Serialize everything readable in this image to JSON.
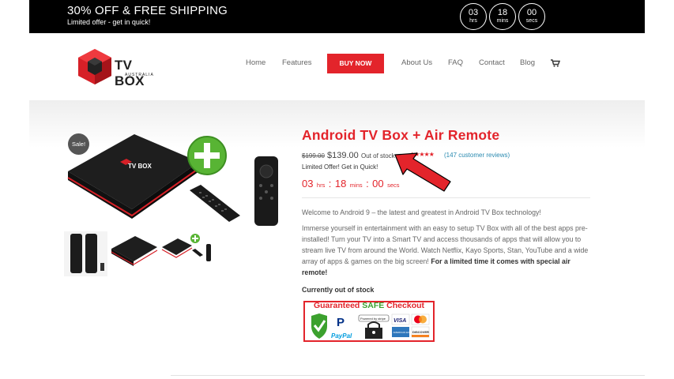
{
  "promo": {
    "title": "30% OFF & FREE SHIPPING",
    "subtitle": "Limited offer - get in quick!",
    "timer": [
      {
        "value": "03",
        "unit": "hrs"
      },
      {
        "value": "18",
        "unit": "mins"
      },
      {
        "value": "00",
        "unit": "secs"
      }
    ]
  },
  "header": {
    "logo_text": "TV BOX",
    "logo_sub": "AUSTRALIA",
    "nav": [
      "Home",
      "Features",
      "BUY NOW",
      "About Us",
      "FAQ",
      "Contact",
      "Blog"
    ],
    "cart_icon": "cart-icon"
  },
  "gallery": {
    "sale_badge": "Sale!"
  },
  "product": {
    "title": "Android TV Box + Air Remote",
    "old_price": "$199.00",
    "price": "$139.00",
    "stock_inline": "Out of stock",
    "rating": "★★★★★",
    "reviews": "(147 customer reviews)",
    "limited_offer": "Limited Offer! Get in Quick!",
    "countdown": {
      "hrs": "03",
      "hrs_label": "hrs",
      "mins": "18",
      "mins_label": "mins",
      "secs": "00",
      "secs_label": "secs"
    },
    "intro": "Welcome to Android 9 – the latest and greatest in Android TV Box technology!",
    "description": "Immerse yourself in entertainment with an easy to setup TV Box with all of the best apps pre-installed! Turn your TV into a Smart TV and access thousands of apps that will allow you to stream live TV from around the World.  Watch Netflix, Kayo Sports, Stan, YouTube and a wide array of apps & games on the big screen! ",
    "description_bold": "For a limited time it comes with special air remote!",
    "stock_note": "Currently out of stock"
  },
  "checkout_badge": {
    "part1": "Guaranteed ",
    "part2": "SAFE",
    "part3": " Checkout",
    "paypal": "PayPal",
    "stripe": "Powered by stripe",
    "visa": "VISA",
    "discover": "DISCOVER",
    "amex": "AMERICAN EXPRESS"
  }
}
